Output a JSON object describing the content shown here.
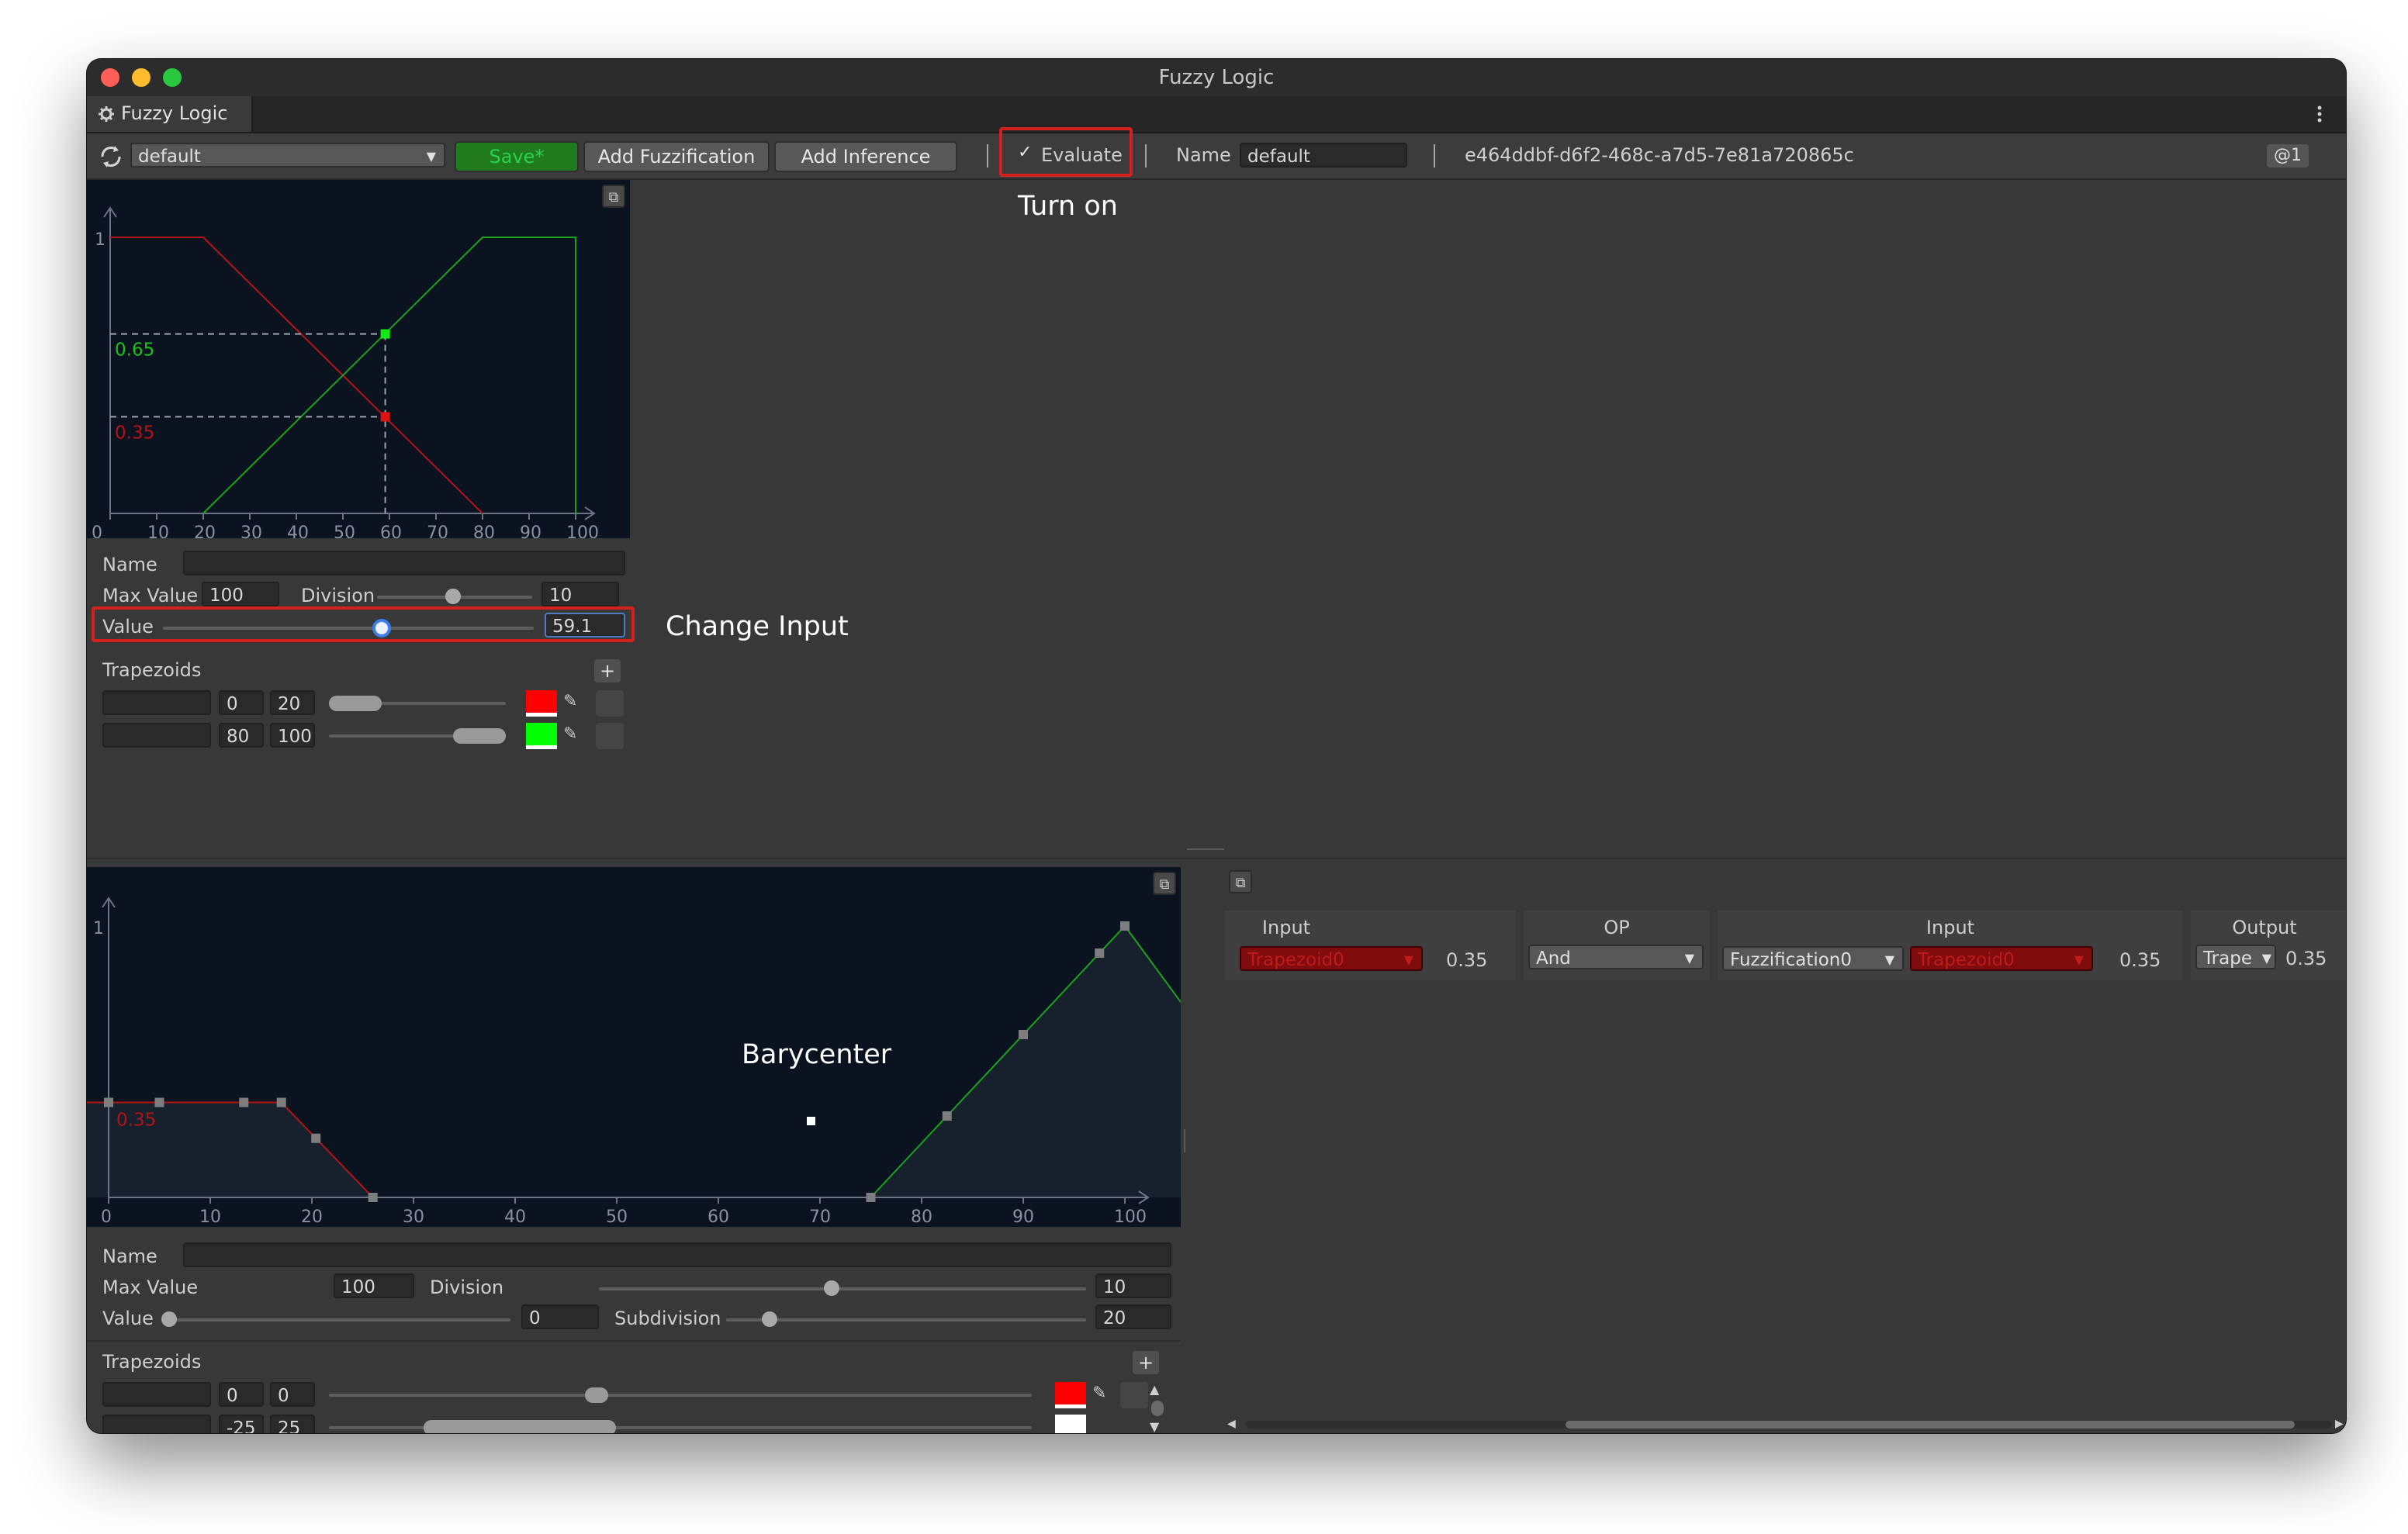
{
  "window": {
    "title": "Fuzzy Logic",
    "tab_label": "Fuzzy Logic",
    "tab_icon": "gear-icon",
    "kebab_icon": "kebab-menu-icon"
  },
  "toolbar": {
    "preset_value": "default",
    "save_label": "Save*",
    "add_fuzzification_label": "Add Fuzzification",
    "add_inference_label": "Add Inference",
    "evaluate_label": "Evaluate",
    "evaluate_checked": true,
    "name_label": "Name",
    "name_value": "default",
    "guid": "e464ddbf-d6f2-468c-a7d5-7e81a720865c",
    "badge": "@1"
  },
  "annotations": {
    "turn_on": "Turn on",
    "change_input": "Change Input",
    "barycenter": "Barycenter"
  },
  "fuzzification": {
    "graph": {
      "y_max_label": "1",
      "x_ticks": [
        "0",
        "10",
        "20",
        "30",
        "40",
        "50",
        "60",
        "70",
        "80",
        "90",
        "100"
      ],
      "green_label": "0.65",
      "red_label": "0.35",
      "input_value": 59.1,
      "red_membership": 0.35,
      "green_membership": 0.65,
      "red_trapezoid": [
        0,
        20
      ],
      "green_trapezoid": [
        80,
        100
      ]
    },
    "name_label": "Name",
    "name_value": "",
    "max_value_label": "Max Value",
    "max_value": "100",
    "division_label": "Division",
    "division_value": "10",
    "value_label": "Value",
    "value_value": "59.1",
    "value_fraction": 0.591,
    "trapezoids_label": "Trapezoids",
    "add_icon": "+",
    "trapezoids": [
      {
        "name": "",
        "a": "0",
        "b": "20",
        "color": "#ff0000"
      },
      {
        "name": "",
        "a": "80",
        "b": "100",
        "color": "#00ff00"
      }
    ]
  },
  "defuzzification": {
    "graph": {
      "y_max_label": "1",
      "x_ticks": [
        "0",
        "10",
        "20",
        "30",
        "40",
        "50",
        "60",
        "70",
        "80",
        "90",
        "100"
      ],
      "red_label": "0.35"
    },
    "name_label": "Name",
    "name_value": "",
    "max_value_label": "Max Value",
    "max_value": "100",
    "division_label": "Division",
    "division_value": "10",
    "value_label": "Value",
    "value_value": "0",
    "subdivision_label": "Subdivision",
    "subdivision_value": "20",
    "trapezoids_label": "Trapezoids",
    "add_icon": "+",
    "trapezoids": [
      {
        "name": "",
        "a": "0",
        "b": "0",
        "color": "#ff0000"
      },
      {
        "name": "",
        "a": "-25",
        "b": "25",
        "color": "#ffffff"
      }
    ]
  },
  "inference": {
    "input1_header": "Input",
    "input1_trapezoid": "Trapezoid0",
    "input1_value": "0.35",
    "op_header": "OP",
    "op_value": "And",
    "input2_header": "Input",
    "input2_source": "Fuzzification0",
    "input2_trapezoid": "Trapezoid0",
    "input2_value": "0.35",
    "output_header": "Output",
    "output_trapezoid": "Trape",
    "output_value": "0.35"
  }
}
